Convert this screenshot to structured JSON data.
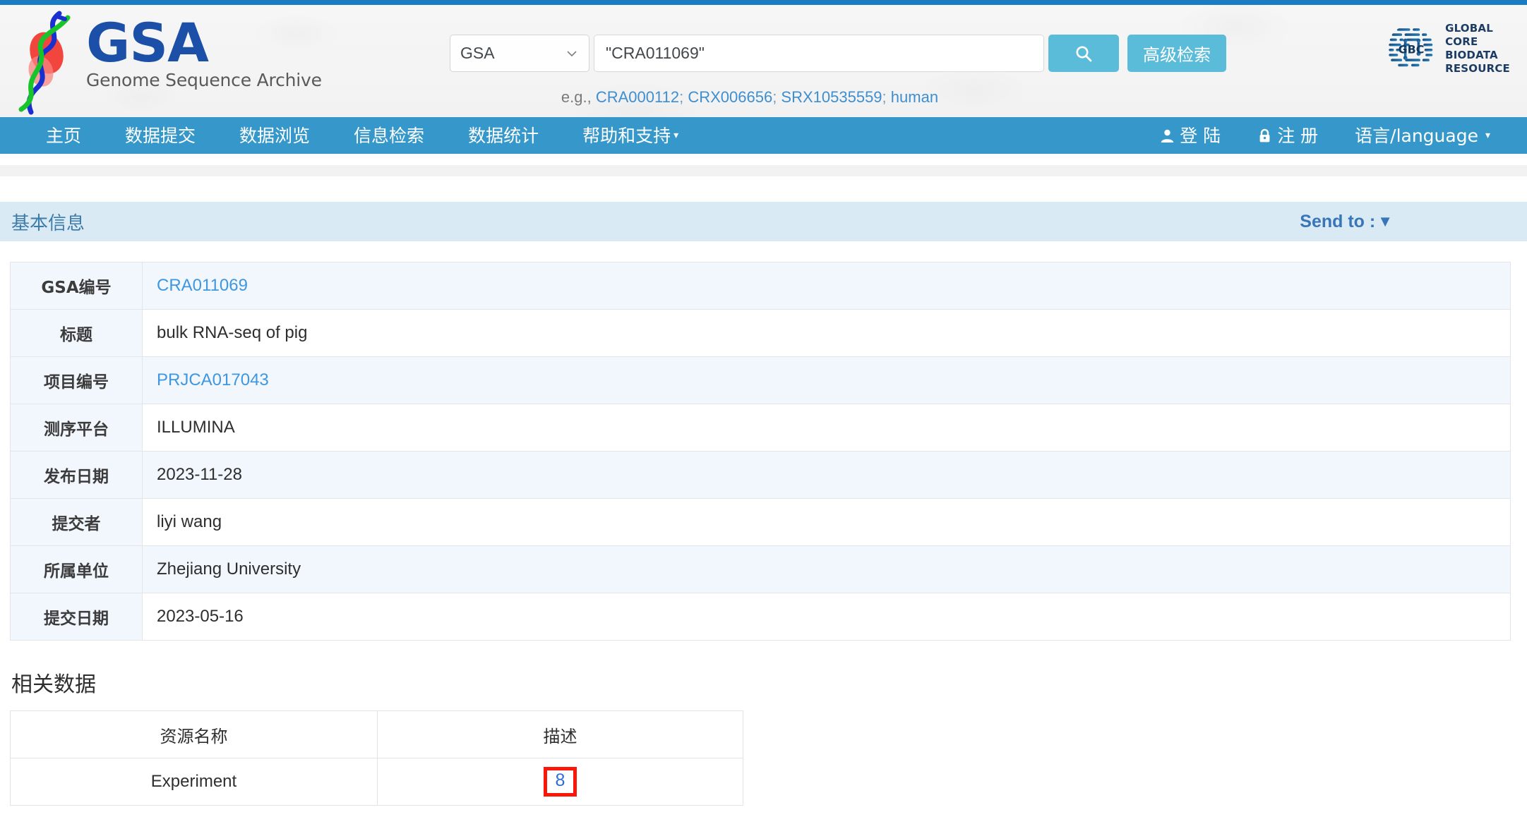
{
  "colors": {
    "accent_blue": "#1b7cc4",
    "nav_blue": "#3698ca",
    "button_cyan": "#5bbcd9",
    "section_bar": "#d9eaf4",
    "link_blue": "#3e97e0",
    "highlight_red": "#fb1707",
    "logo_blue": "#1b4fa8"
  },
  "header": {
    "logo_title": "GSA",
    "logo_subtitle": "Genome Sequence Archive",
    "logo_icon": "dna-helix-icon",
    "search": {
      "db_selected": "GSA",
      "db_options": [
        "GSA"
      ],
      "query_value": "\"CRA011069\"",
      "query_placeholder": "",
      "search_icon": "magnifier-icon",
      "advanced_label": "高级检索"
    },
    "examples": {
      "prefix": "e.g., ",
      "items": [
        "CRA000112",
        "CRX006656",
        "SRX10535559",
        "human"
      ],
      "separator": "; "
    },
    "gcbr": {
      "mark_text": "GBC",
      "line1": "GLOBAL",
      "line2": "CORE",
      "line3": "BIODATA",
      "line4": "RESOURCE"
    }
  },
  "nav": {
    "items": [
      {
        "label": "主页",
        "caret": ""
      },
      {
        "label": "数据提交",
        "caret": ""
      },
      {
        "label": "数据浏览",
        "caret": ""
      },
      {
        "label": "信息检索",
        "caret": ""
      },
      {
        "label": "数据统计",
        "caret": ""
      },
      {
        "label": "帮助和支持",
        "caret": "▾"
      }
    ],
    "right": [
      {
        "label": "登 陆",
        "icon": "user-icon"
      },
      {
        "label": "注 册",
        "icon": "lock-icon"
      },
      {
        "label": "语言/language",
        "icon": "",
        "caret": "▾"
      }
    ]
  },
  "section": {
    "title": "基本信息",
    "send_to_label": "Send to :",
    "send_to_caret": "▼"
  },
  "info_table": {
    "rows": [
      {
        "label": "GSA编号",
        "value": "CRA011069",
        "is_link": true
      },
      {
        "label": "标题",
        "value": "bulk RNA-seq of pig",
        "is_link": false
      },
      {
        "label": "项目编号",
        "value": "PRJCA017043",
        "is_link": true
      },
      {
        "label": "测序平台",
        "value": "ILLUMINA",
        "is_link": false
      },
      {
        "label": "发布日期",
        "value": "2023-11-28",
        "is_link": false
      },
      {
        "label": "提交者",
        "value": "liyi wang",
        "is_link": false
      },
      {
        "label": "所属单位",
        "value": "Zhejiang University",
        "is_link": false
      },
      {
        "label": "提交日期",
        "value": "2023-05-16",
        "is_link": false
      }
    ]
  },
  "related": {
    "heading": "相关数据",
    "columns": [
      "资源名称",
      "描述"
    ],
    "rows": [
      {
        "resource": "Experiment",
        "count": "8",
        "count_highlighted": true
      }
    ]
  }
}
